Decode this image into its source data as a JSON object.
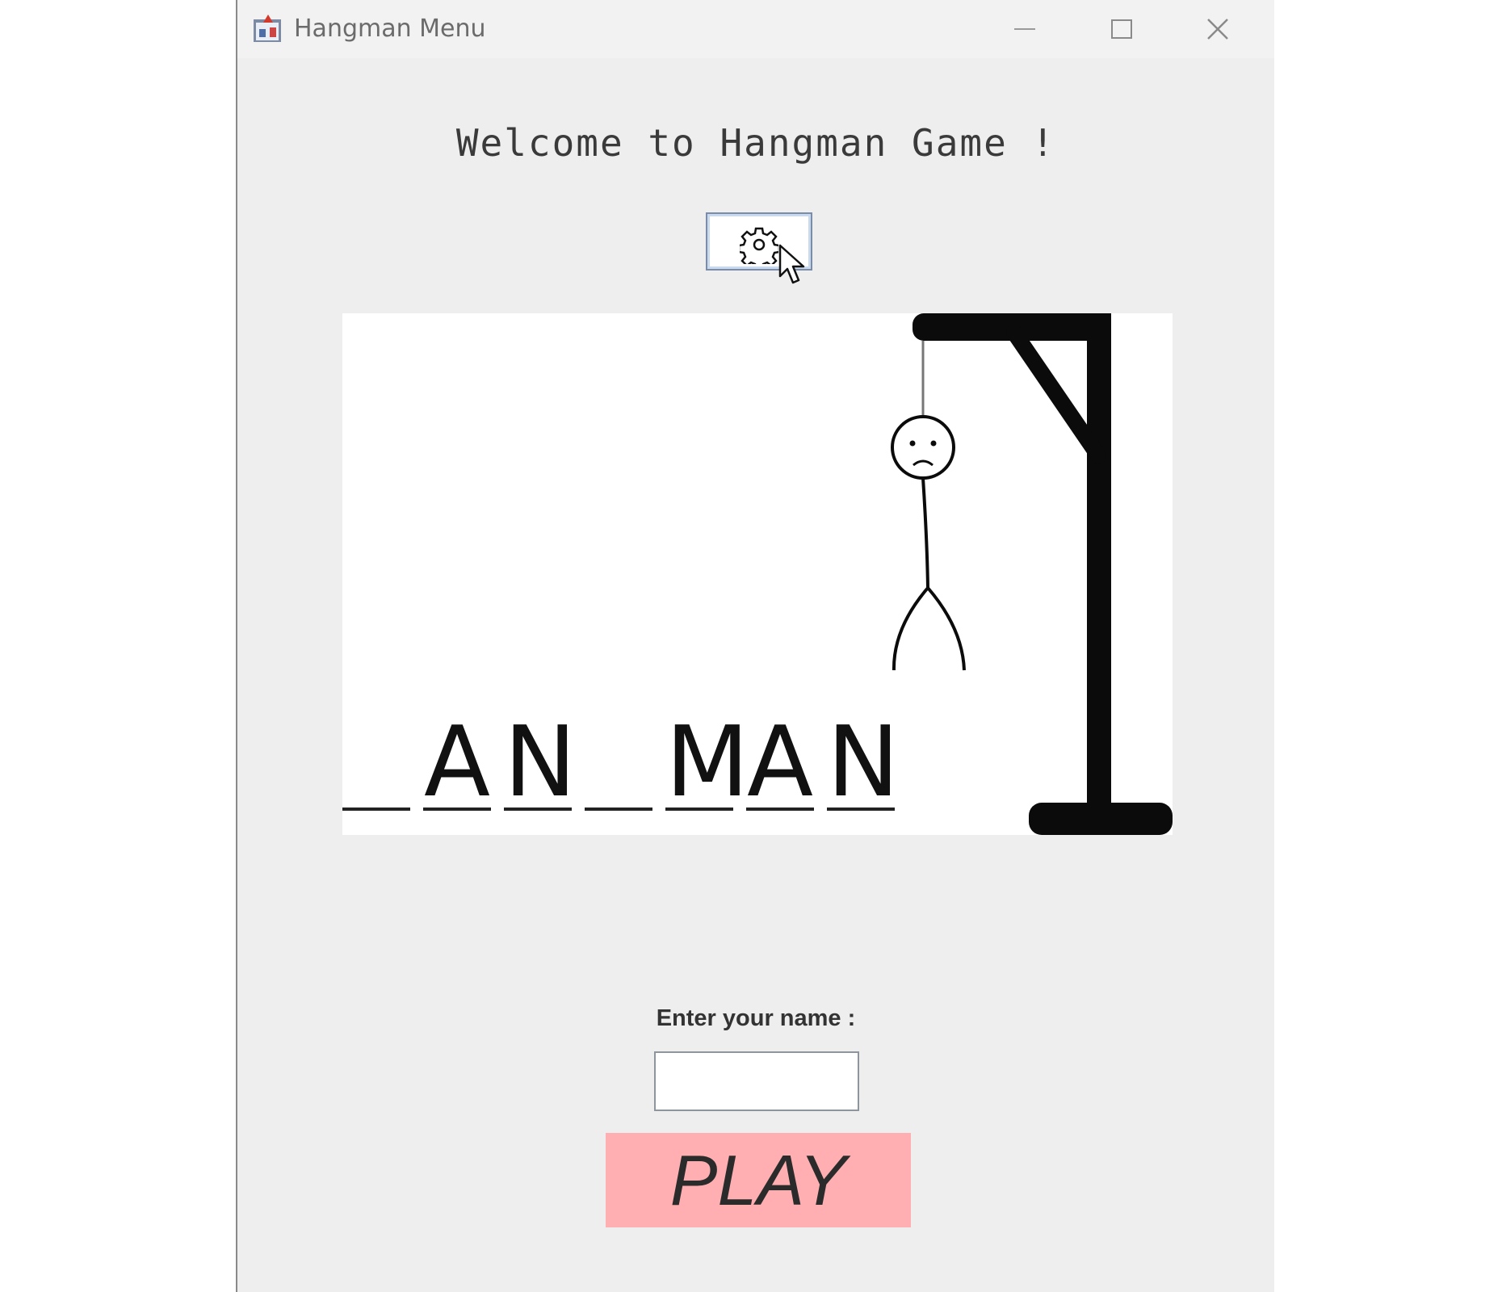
{
  "window": {
    "title": "Hangman Menu",
    "icons": [
      "app-icon",
      "minimize-icon",
      "maximize-icon",
      "close-icon"
    ]
  },
  "main": {
    "welcome_text": "Welcome to Hangman Game !",
    "settings_button_icon": "gear-icon",
    "word_display": [
      "",
      "A",
      "N",
      "",
      "M",
      "A",
      "N"
    ],
    "name_label": "Enter your name :",
    "name_input_value": "",
    "play_label": "PLAY"
  },
  "colors": {
    "window_bg": "#eeeeee",
    "play_button_bg": "#ffafb1"
  }
}
